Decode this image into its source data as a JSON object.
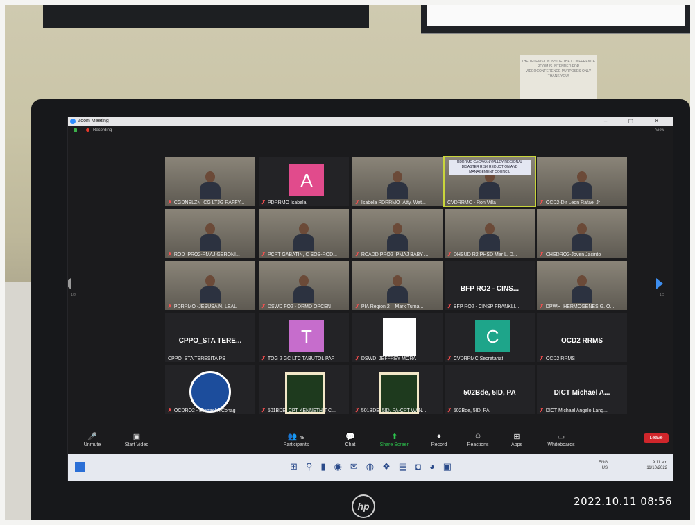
{
  "window": {
    "title": "Zoom Meeting",
    "recording_label": "Recording",
    "view_label": "View",
    "controls": "– ▢ ✕"
  },
  "pagination": {
    "left": "1/2",
    "right": "1/2"
  },
  "tiles": [
    {
      "name": "CGDNELZN_CG LTJG RAFFY...",
      "kind": "camera",
      "muted": true
    },
    {
      "name": "PDRRMO Isabela",
      "kind": "avatar",
      "letter": "A",
      "color": "#e14b8c",
      "muted": true
    },
    {
      "name": "Isabela PDRRMO_Atty. Wat...",
      "kind": "camera",
      "muted": true
    },
    {
      "name": "CVDRRMC - Ron Villa",
      "kind": "camera",
      "muted": false,
      "highlight": true,
      "caption": "RDRRMC  CAGAYAN VALLEY REGIONAL DISASTER RISK REDUCTION AND MANAGEMENT COUNCIL"
    },
    {
      "name": "OCD2-Dir Leon Rafael Jr",
      "kind": "camera",
      "muted": true
    },
    {
      "name": "ROD_PRO2-PMAJ GERONI...",
      "kind": "camera",
      "muted": true
    },
    {
      "name": "PCPT GABATIN, C SOS-ROD...",
      "kind": "camera",
      "muted": true
    },
    {
      "name": "RCADD PRO2_PMAJ BABY ...",
      "kind": "camera",
      "muted": true
    },
    {
      "name": "DHSUD R2 PHSD Mar L. D...",
      "kind": "camera",
      "muted": true
    },
    {
      "name": "CHEDRO2-Joven Jacinto",
      "kind": "camera",
      "muted": true
    },
    {
      "name": "PDRRMO -JESUSA N. LEAL",
      "kind": "camera",
      "muted": true
    },
    {
      "name": "DSWD FO2 - DRMD OPCEN",
      "kind": "camera",
      "muted": true
    },
    {
      "name": "PIA Region 2 _ Mark Tuma...",
      "kind": "camera",
      "muted": true
    },
    {
      "name": "BFP RO2 - CINSP FRANKLI...",
      "kind": "text",
      "big": "BFP RO2 - CINS...",
      "muted": true
    },
    {
      "name": "DPWH_HERMOGENES G. O...",
      "kind": "camera",
      "muted": true
    },
    {
      "name": "CPPO_STA TERESITA PS",
      "kind": "text",
      "big": "CPPO_STA TERE...",
      "muted": false
    },
    {
      "name": "TOG 2 GC LTC TABUTOL PAF",
      "kind": "avatar",
      "letter": "T",
      "color": "#c66dcc",
      "muted": true
    },
    {
      "name": "DSWD_JEFFREY MORA",
      "kind": "ribbon",
      "muted": true
    },
    {
      "name": "CVDRRMC Secretariat",
      "kind": "avatar",
      "letter": "C",
      "color": "#1ea58a",
      "muted": true
    },
    {
      "name": "OCD2 RRMS",
      "kind": "text",
      "big": "OCD2 RRMS",
      "muted": true
    },
    {
      "name": "OCDRO2 - Michael A Conag",
      "kind": "round-logo",
      "muted": true
    },
    {
      "name": "501BDE, CPT KENNETH T C...",
      "kind": "badge-logo",
      "muted": true
    },
    {
      "name": "501BDE, 5ID, PA-CPT WAN...",
      "kind": "badge-logo",
      "muted": true
    },
    {
      "name": "502Bde, 5ID, PA",
      "kind": "text",
      "big": "502Bde, 5ID, PA",
      "muted": true
    },
    {
      "name": "DICT Michael Angelo Lang...",
      "kind": "text",
      "big": "DICT Michael A...",
      "muted": true
    }
  ],
  "toolbar": {
    "unmute": "Unmute",
    "start_video": "Start Video",
    "participants": "Participants",
    "participant_count": "48",
    "chat": "Chat",
    "share_screen": "Share Screen",
    "record": "Record",
    "reactions": "Reactions",
    "apps": "Apps",
    "whiteboards": "Whiteboards",
    "leave": "Leave"
  },
  "taskbar": {
    "lang": "ENG",
    "lang2": "US",
    "time": "9:11 am",
    "date": "11/10/2022"
  },
  "brand": "hp",
  "photo_timestamp": "2022.10.11 08:56",
  "wall_notice": "THE TELEVISION INSIDE THE CONFERENCE ROOM IS INTENDED FOR VIDEOCONFERENCE PURPOSES ONLY THANK YOU!"
}
